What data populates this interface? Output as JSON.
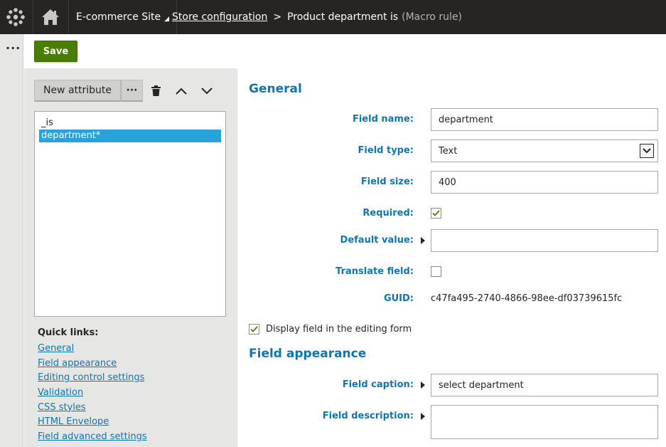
{
  "header": {
    "site_name": "E-commerce Site",
    "breadcrumb_link": "Store configuration",
    "breadcrumb_separator": ">",
    "breadcrumb_current": "Product department is",
    "breadcrumb_suffix": "(Macro rule)"
  },
  "toolbar": {
    "save_label": "Save"
  },
  "attributes": {
    "new_label": "New attribute",
    "items": [
      "_is",
      "department*"
    ],
    "selected_index": 1
  },
  "quick_links": {
    "title": "Quick links:",
    "items": [
      "General",
      "Field appearance",
      "Editing control settings",
      "Validation",
      "CSS styles",
      "HTML Envelope",
      "Field advanced settings"
    ]
  },
  "general": {
    "title": "General",
    "field_name_label": "Field name:",
    "field_name_value": "department",
    "field_type_label": "Field type:",
    "field_type_value": "Text",
    "field_size_label": "Field size:",
    "field_size_value": "400",
    "required_label": "Required:",
    "required_checked": true,
    "default_value_label": "Default value:",
    "default_value": "",
    "translate_label": "Translate field:",
    "translate_checked": false,
    "guid_label": "GUID:",
    "guid_value": "c47fa495-2740-4866-98ee-df03739615fc",
    "display_field_label": "Display field in the editing form",
    "display_field_checked": true
  },
  "appearance": {
    "title": "Field appearance",
    "caption_label": "Field caption:",
    "caption_value": "select department",
    "description_label": "Field description:",
    "description_value": ""
  },
  "colors": {
    "header_bg": "#262524",
    "save_green": "#497d04",
    "label_blue": "#1175ae",
    "selected_blue": "#27a2db",
    "panel_gray": "#e6e6e5"
  }
}
